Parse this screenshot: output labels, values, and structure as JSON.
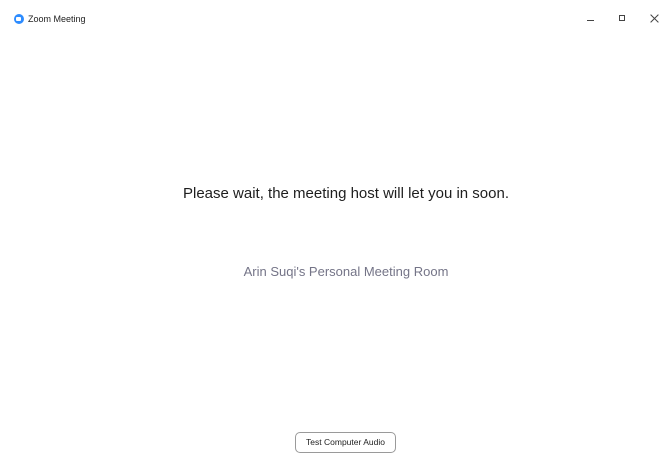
{
  "window": {
    "title": "Zoom Meeting",
    "app_icon": "zoom-logo-icon",
    "controls": [
      "minimize-icon",
      "maximize-icon",
      "close-icon"
    ]
  },
  "main": {
    "message": "Please wait, the meeting host will let you in soon.",
    "room_name": "Arin Suqi's Personal Meeting Room"
  },
  "footer": {
    "test_audio_label": "Test Computer Audio"
  },
  "colors": {
    "accent": "#2d8cff",
    "message_text": "#1e1e1e",
    "room_text": "#747487"
  }
}
